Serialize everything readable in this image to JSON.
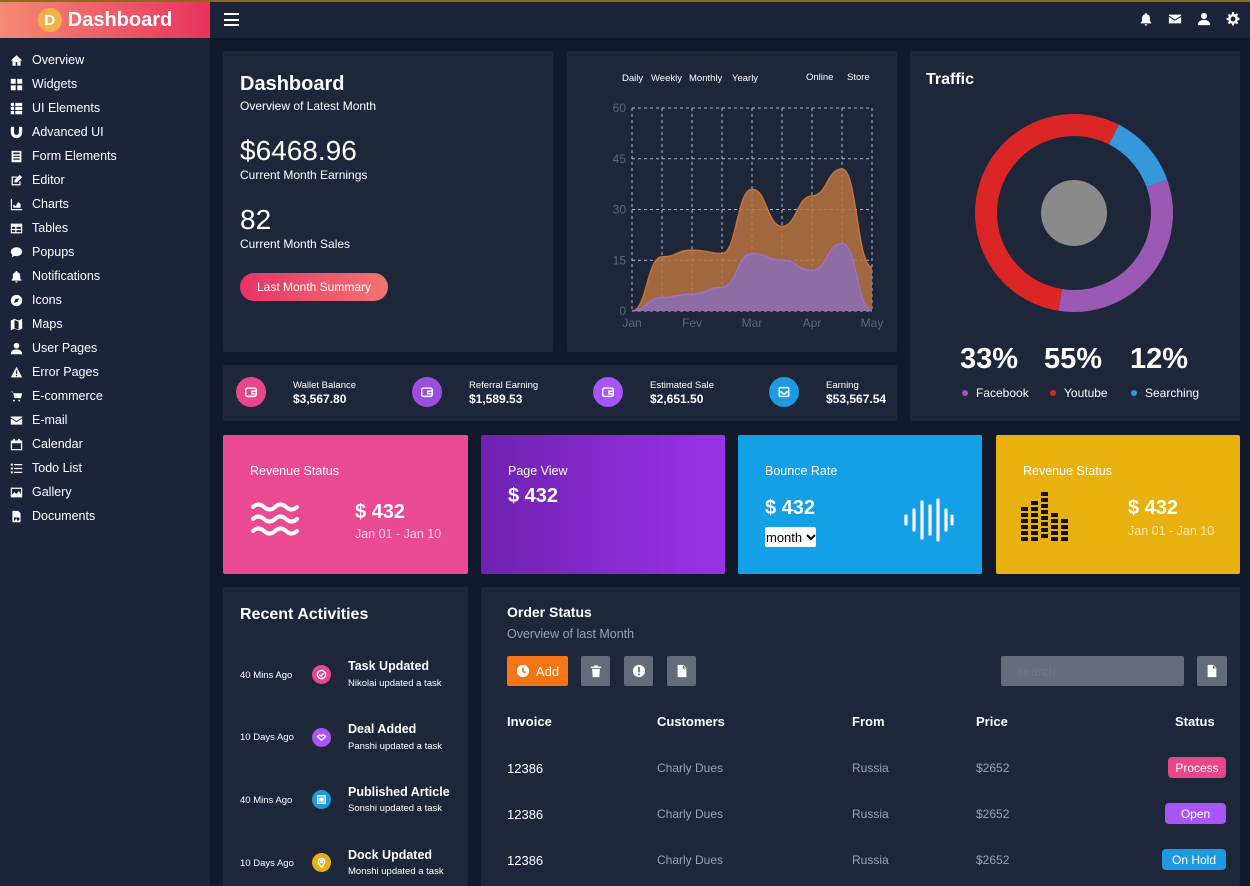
{
  "brand": {
    "initial": "D",
    "name": "Dashboard"
  },
  "sidebar": {
    "items": [
      {
        "label": "Overview",
        "icon": "home-icon"
      },
      {
        "label": "Widgets",
        "icon": "widgets-icon"
      },
      {
        "label": "UI Elements",
        "icon": "list-grid-icon"
      },
      {
        "label": "Advanced UI",
        "icon": "magnet-icon"
      },
      {
        "label": "Form Elements",
        "icon": "form-icon"
      },
      {
        "label": "Editor",
        "icon": "edit-icon"
      },
      {
        "label": "Charts",
        "icon": "chart-icon"
      },
      {
        "label": "Tables",
        "icon": "table-icon"
      },
      {
        "label": "Popups",
        "icon": "chat-icon"
      },
      {
        "label": "Notifications",
        "icon": "bell-icon"
      },
      {
        "label": "Icons",
        "icon": "compass-icon"
      },
      {
        "label": "Maps",
        "icon": "map-icon"
      },
      {
        "label": "User Pages",
        "icon": "user-icon"
      },
      {
        "label": "Error Pages",
        "icon": "warning-icon"
      },
      {
        "label": "E-commerce",
        "icon": "cart-icon"
      },
      {
        "label": "E-mail",
        "icon": "mail-icon"
      },
      {
        "label": "Calendar",
        "icon": "calendar-icon"
      },
      {
        "label": "Todo List",
        "icon": "todo-icon"
      },
      {
        "label": "Gallery",
        "icon": "image-icon"
      },
      {
        "label": "Documents",
        "icon": "pdf-icon"
      }
    ]
  },
  "summary": {
    "title": "Dashboard",
    "subtitle": "Overview of Latest Month",
    "earnings": "$6468.96",
    "earnings_label": "Current Month Earnings",
    "sales": "82",
    "sales_label": "Current Month Sales",
    "button": "Last Month Summary"
  },
  "chart_tabs": {
    "daily": "Daily",
    "weekly": "Weekly",
    "monthly": "Monthly",
    "yearly": "Yearly",
    "online": "Online",
    "store": "Store"
  },
  "chart_data": {
    "type": "area",
    "categories": [
      "Jan",
      "Fev",
      "Mar",
      "Apr",
      "May"
    ],
    "x": [
      0,
      0.5,
      1,
      1.5,
      2,
      2.5,
      3,
      3.5,
      4
    ],
    "ylim": [
      0,
      60
    ],
    "yticks": [
      0,
      15,
      30,
      45,
      60
    ],
    "grid": true,
    "series": [
      {
        "values": [
          0,
          16,
          18,
          17,
          36,
          25,
          34,
          42,
          13
        ],
        "color": "#b87340"
      },
      {
        "values": [
          0,
          4,
          5,
          7,
          17,
          15,
          12,
          20,
          0
        ],
        "color": "#8a6fb5"
      }
    ]
  },
  "traffic": {
    "title": "Traffic",
    "items": [
      {
        "pct": "33%",
        "label": "Facebook",
        "value": 33,
        "color": "#9b59b6"
      },
      {
        "pct": "55%",
        "label": "Youtube",
        "value": 55,
        "color": "#dc2626"
      },
      {
        "pct": "12%",
        "label": "Searching",
        "value": 12,
        "color": "#3498db"
      }
    ],
    "center_color": "#8a8a8a"
  },
  "stats": [
    {
      "label": "Wallet Balance",
      "value": "$3,567.80",
      "color": "#e8478b",
      "icon": "wallet-icon"
    },
    {
      "label": "Referral Earning",
      "value": "$1,589.53",
      "color": "#9b4de0",
      "icon": "wallet-icon"
    },
    {
      "label": "Estimated Sale",
      "value": "$2,651.50",
      "color": "#a855f7",
      "icon": "wallet-icon"
    },
    {
      "label": "Earning",
      "value": "$53,567.54",
      "color": "#1e9ae0",
      "icon": "inbox-icon"
    }
  ],
  "tiles": [
    {
      "label": "Revenue Status",
      "value": "$ 432",
      "date": "Jan 01 - Jan 10",
      "color": "#ea4a92"
    },
    {
      "label": "Page View",
      "value": "$ 432",
      "color": "#8b2fd9"
    },
    {
      "label": "Bounce Rate",
      "value": "$ 432",
      "select": "month",
      "color": "#13a0e6"
    },
    {
      "label": "Revenue Status",
      "value": "$ 432",
      "date": "Jan 01 - Jan 10",
      "color": "#e9b10d"
    }
  ],
  "activities": {
    "title": "Recent Activities",
    "items": [
      {
        "time": "40 Mins Ago",
        "title": "Task Updated",
        "desc": "Nikolai updated a task",
        "color": "#e8478b",
        "icon": "check-circle-icon"
      },
      {
        "time": "10 Days Ago",
        "title": "Deal Added",
        "desc": "Panshi updated a task",
        "color": "#a855f7",
        "icon": "handshake-icon"
      },
      {
        "time": "40 Mins Ago",
        "title": "Published Article",
        "desc": "Sonshi updated a task",
        "color": "#1e9ae0",
        "icon": "newspaper-icon"
      },
      {
        "time": "10 Days Ago",
        "title": "Dock Updated",
        "desc": "Monshi updated a task",
        "color": "#e9b10d",
        "icon": "pin-icon"
      }
    ]
  },
  "orders": {
    "title": "Order Status",
    "subtitle": "Overview of last Month",
    "add_label": "Add",
    "search_placeholder": "search",
    "columns": [
      "Invoice",
      "Customers",
      "From",
      "Price",
      "Status"
    ],
    "rows": [
      {
        "invoice": "12386",
        "customer": "Charly Dues",
        "from": "Russia",
        "price": "$2652",
        "status": "Process",
        "color": "#e8478b"
      },
      {
        "invoice": "12386",
        "customer": "Charly Dues",
        "from": "Russia",
        "price": "$2652",
        "status": "Open",
        "color": "#a855f7"
      },
      {
        "invoice": "12386",
        "customer": "Charly Dues",
        "from": "Russia",
        "price": "$2652",
        "status": "On Hold",
        "color": "#1e9ae0"
      }
    ]
  }
}
